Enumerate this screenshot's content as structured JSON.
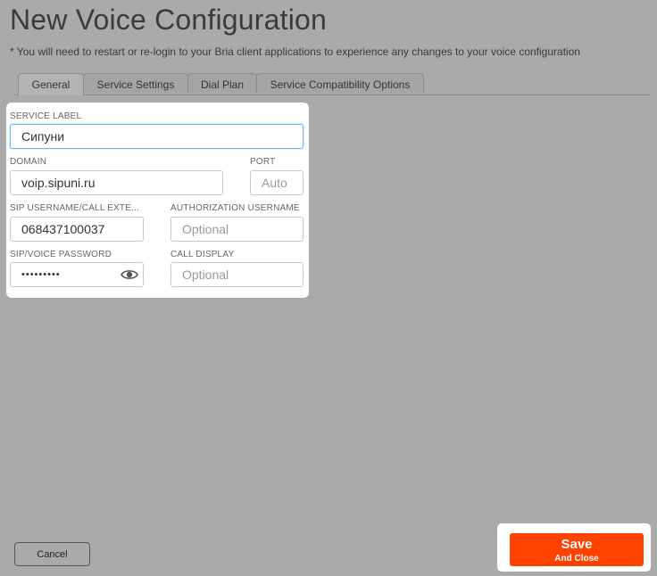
{
  "page": {
    "title": "New Voice Configuration",
    "notice": "* You will need to restart or re-login to your Bria client applications to experience any changes to your voice configuration"
  },
  "tabs": [
    {
      "label": "General",
      "active": true
    },
    {
      "label": "Service Settings",
      "active": false
    },
    {
      "label": "Dial Plan",
      "active": false
    },
    {
      "label": "Service Compatibility Options",
      "active": false
    }
  ],
  "form": {
    "service_label": {
      "label": "SERVICE LABEL",
      "value": "Сипуни"
    },
    "domain": {
      "label": "DOMAIN",
      "value": "voip.sipuni.ru"
    },
    "port": {
      "label": "PORT",
      "value": "",
      "placeholder": "Auto"
    },
    "sip_username": {
      "label": "SIP USERNAME/CALL EXTE...",
      "value": "068437100037"
    },
    "auth_username": {
      "label": "AUTHORIZATION USERNAME",
      "value": "",
      "placeholder": "Optional"
    },
    "password": {
      "label": "SIP/VOICE PASSWORD",
      "value": "•••••••••",
      "icon": "eye-icon"
    },
    "call_display": {
      "label": "CALL DISPLAY",
      "value": "",
      "placeholder": "Optional"
    }
  },
  "footer": {
    "cancel_label": "Cancel",
    "save_label": "Save",
    "save_sublabel": "And Close",
    "save_color": "#ff4200"
  }
}
